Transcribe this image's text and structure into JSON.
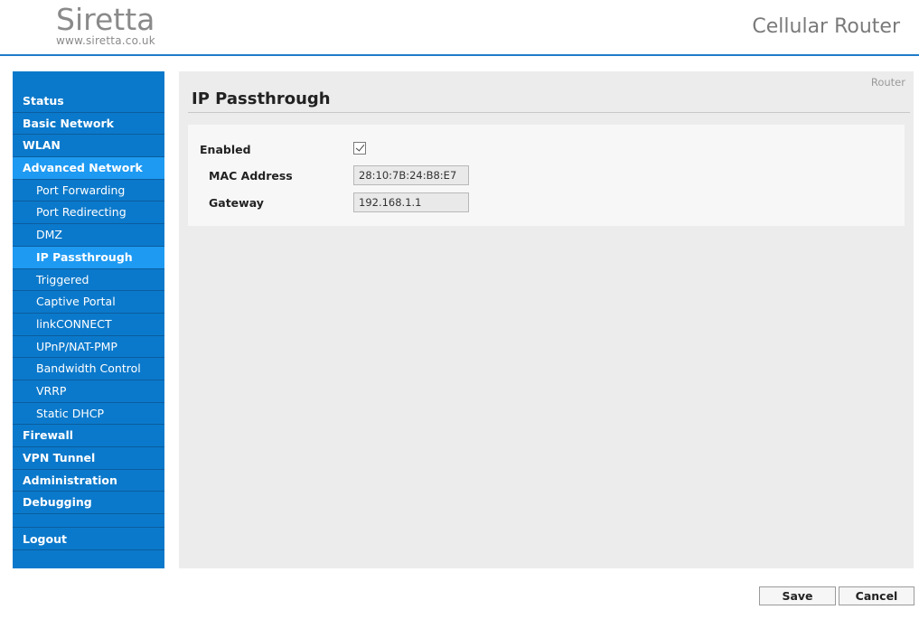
{
  "header": {
    "logo_name": "Siretta",
    "logo_url": "www.siretta.co.uk",
    "product": "Cellular Router"
  },
  "sidebar": {
    "items": [
      {
        "label": "Status",
        "type": "top"
      },
      {
        "label": "Basic Network",
        "type": "top"
      },
      {
        "label": "WLAN",
        "type": "top"
      },
      {
        "label": "Advanced Network",
        "type": "top",
        "state": "expanded"
      },
      {
        "label": "Port Forwarding",
        "type": "sub"
      },
      {
        "label": "Port Redirecting",
        "type": "sub"
      },
      {
        "label": "DMZ",
        "type": "sub"
      },
      {
        "label": "IP Passthrough",
        "type": "sub",
        "state": "selected"
      },
      {
        "label": "Triggered",
        "type": "sub"
      },
      {
        "label": "Captive Portal",
        "type": "sub"
      },
      {
        "label": "linkCONNECT",
        "type": "sub"
      },
      {
        "label": "UPnP/NAT-PMP",
        "type": "sub"
      },
      {
        "label": "Bandwidth Control",
        "type": "sub"
      },
      {
        "label": "VRRP",
        "type": "sub"
      },
      {
        "label": "Static DHCP",
        "type": "sub"
      },
      {
        "label": "Firewall",
        "type": "top"
      },
      {
        "label": "VPN Tunnel",
        "type": "top"
      },
      {
        "label": "Administration",
        "type": "top"
      },
      {
        "label": "Debugging",
        "type": "top"
      }
    ],
    "logout": "Logout"
  },
  "main": {
    "breadcrumb": "Router",
    "title": "IP Passthrough",
    "form": {
      "enabled_label": "Enabled",
      "enabled_checked": true,
      "mac_label": "MAC Address",
      "mac_value": "28:10:7B:24:B8:E7",
      "gateway_label": "Gateway",
      "gateway_value": "192.168.1.1"
    }
  },
  "buttons": {
    "save": "Save",
    "cancel": "Cancel"
  },
  "colors": {
    "sidebar_bg": "#0b79cb",
    "sidebar_active": "#1e9af2",
    "header_rule": "#1f7cc8",
    "panel_bg": "#ececec"
  }
}
